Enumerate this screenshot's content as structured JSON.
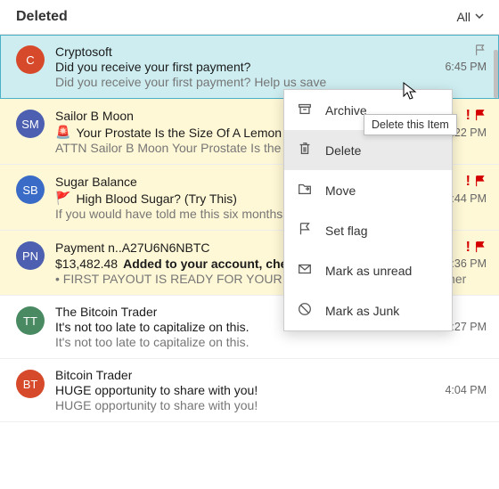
{
  "header": {
    "title": "Deleted",
    "filter_label": "All"
  },
  "messages": [
    {
      "avatar_text": "C",
      "avatar_bg": "#D64A2B",
      "sender": "Cryptosoft",
      "emoji": "",
      "subject_plain": "Did you receive your first payment?",
      "subject_bold": "",
      "preview": "Did you receive your first payment? Help us save",
      "time": "6:45 PM",
      "important": false,
      "flag": "gray",
      "selected": true,
      "flagged_bg": false
    },
    {
      "avatar_text": "SM",
      "avatar_bg": "#4C5FB0",
      "sender": "Sailor B Moon",
      "emoji": "🚨",
      "subject_plain": "Your Prostate Is the Size Of A Lemon",
      "subject_bold": "",
      "preview": "ATTN Sailor B Moon Your Prostate Is the Size Of A Lemon",
      "time": "6:22 PM",
      "important": true,
      "flag": "red",
      "selected": false,
      "flagged_bg": true
    },
    {
      "avatar_text": "SB",
      "avatar_bg": "#3A6CC7",
      "sender": "Sugar Balance",
      "emoji": "🚩",
      "subject_plain": "High Blood Sugar? (Try This)",
      "subject_bold": "",
      "preview": "If you would have told me this six months ago I'd be crazy",
      "time": "4:44 PM",
      "important": true,
      "flag": "red",
      "selected": false,
      "flagged_bg": true
    },
    {
      "avatar_text": "PN",
      "avatar_bg": "#4C5FB0",
      "sender": "Payment n..A27U6N6NBTC",
      "emoji": "",
      "subject_plain": "$13,482.48 ",
      "subject_bold": "Added to your account, check it now",
      "preview": "• FIRST PAYOUT IS READY FOR YOUR CONFIRMATION Dear customer",
      "time": "4:36 PM",
      "important": true,
      "flag": "red",
      "selected": false,
      "flagged_bg": true
    },
    {
      "avatar_text": "TT",
      "avatar_bg": "#4A8A63",
      "sender": "The Bitcoin Trader",
      "emoji": "",
      "subject_plain": "It's not too late to capitalize on this.",
      "subject_bold": "",
      "preview": "It's not too late to capitalize on this.",
      "time": "4:27 PM",
      "important": false,
      "flag": "",
      "selected": false,
      "flagged_bg": false
    },
    {
      "avatar_text": "BT",
      "avatar_bg": "#D64A2B",
      "sender": "Bitcoin Trader",
      "emoji": "",
      "subject_plain": "HUGE opportunity to share with you!",
      "subject_bold": "",
      "preview": "HUGE opportunity to share with you!",
      "time": "4:04 PM",
      "important": false,
      "flag": "",
      "selected": false,
      "flagged_bg": false
    }
  ],
  "context_menu": {
    "items": [
      {
        "label": "Archive",
        "icon": "archive"
      },
      {
        "label": "Delete",
        "icon": "trash",
        "hover": true
      },
      {
        "label": "Move",
        "icon": "move"
      },
      {
        "label": "Set flag",
        "icon": "flag"
      },
      {
        "label": "Mark as unread",
        "icon": "mail"
      },
      {
        "label": "Mark as Junk",
        "icon": "junk"
      }
    ]
  },
  "tooltip": "Delete this Item"
}
